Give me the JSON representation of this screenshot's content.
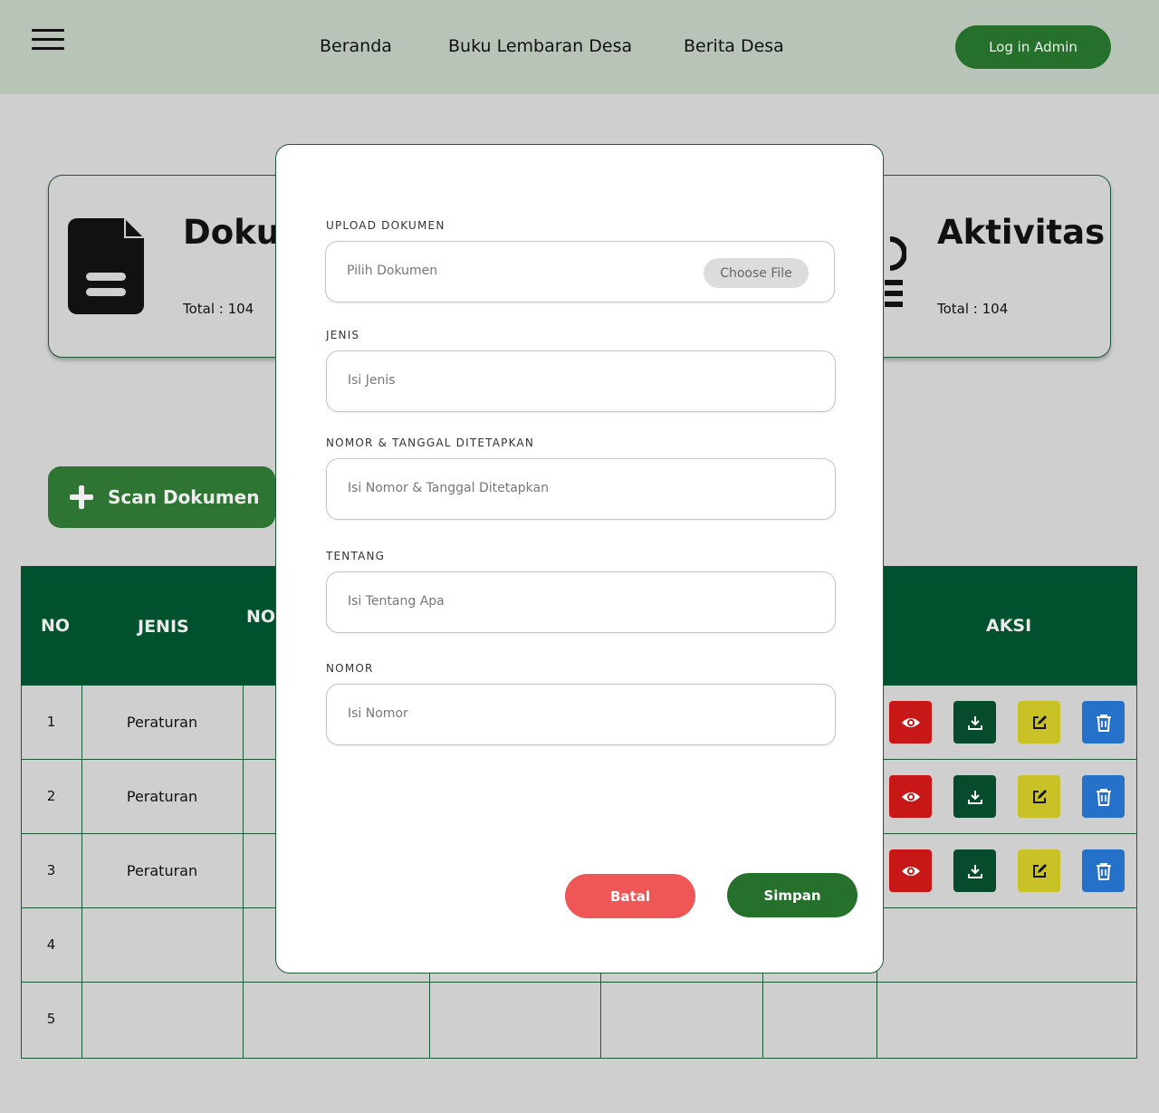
{
  "nav": {
    "links": [
      "Beranda",
      "Buku Lembaran Desa",
      "Berita Desa"
    ],
    "login_label": "Log in Admin"
  },
  "cards": {
    "documents": {
      "title": "Dokumen",
      "total": "Total : 104"
    },
    "activity": {
      "title": "Aktivitas",
      "total": "Total : 104"
    }
  },
  "scan_button": "Scan Dokumen",
  "table": {
    "headers": {
      "no": "NO",
      "jenis": "JENIS",
      "nomor_partial": "NO",
      "aksi": "AKSI"
    },
    "rows": [
      {
        "no": "1",
        "jenis": "Peraturan"
      },
      {
        "no": "2",
        "jenis": "Peraturan"
      },
      {
        "no": "3",
        "jenis": "Peraturan"
      },
      {
        "no": "4",
        "jenis": ""
      },
      {
        "no": "5",
        "jenis": ""
      }
    ]
  },
  "modal": {
    "upload": {
      "label": "UPLOAD DOKUMEN",
      "placeholder": "Pilih Dokumen",
      "choose_label": "Choose File"
    },
    "jenis": {
      "label": "JENIS",
      "placeholder": "Isi Jenis"
    },
    "nomor_tanggal": {
      "label": "NOMOR & TANGGAL DITETAPKAN",
      "placeholder": "Isi Nomor & Tanggal Ditetapkan"
    },
    "tentang": {
      "label": "TENTANG",
      "placeholder": "Isi Tentang Apa"
    },
    "nomor": {
      "label": "NOMOR",
      "placeholder": "Isi Nomor"
    },
    "cancel_label": "Batal",
    "save_label": "Simpan"
  },
  "colors": {
    "header_bg": "#b8c4b8",
    "accent_green": "#25702a",
    "table_header": "#00522e",
    "view": "#c81717",
    "download": "#064b2c",
    "edit": "#c9c227",
    "delete": "#2570c8",
    "cancel": "#ef5656"
  }
}
